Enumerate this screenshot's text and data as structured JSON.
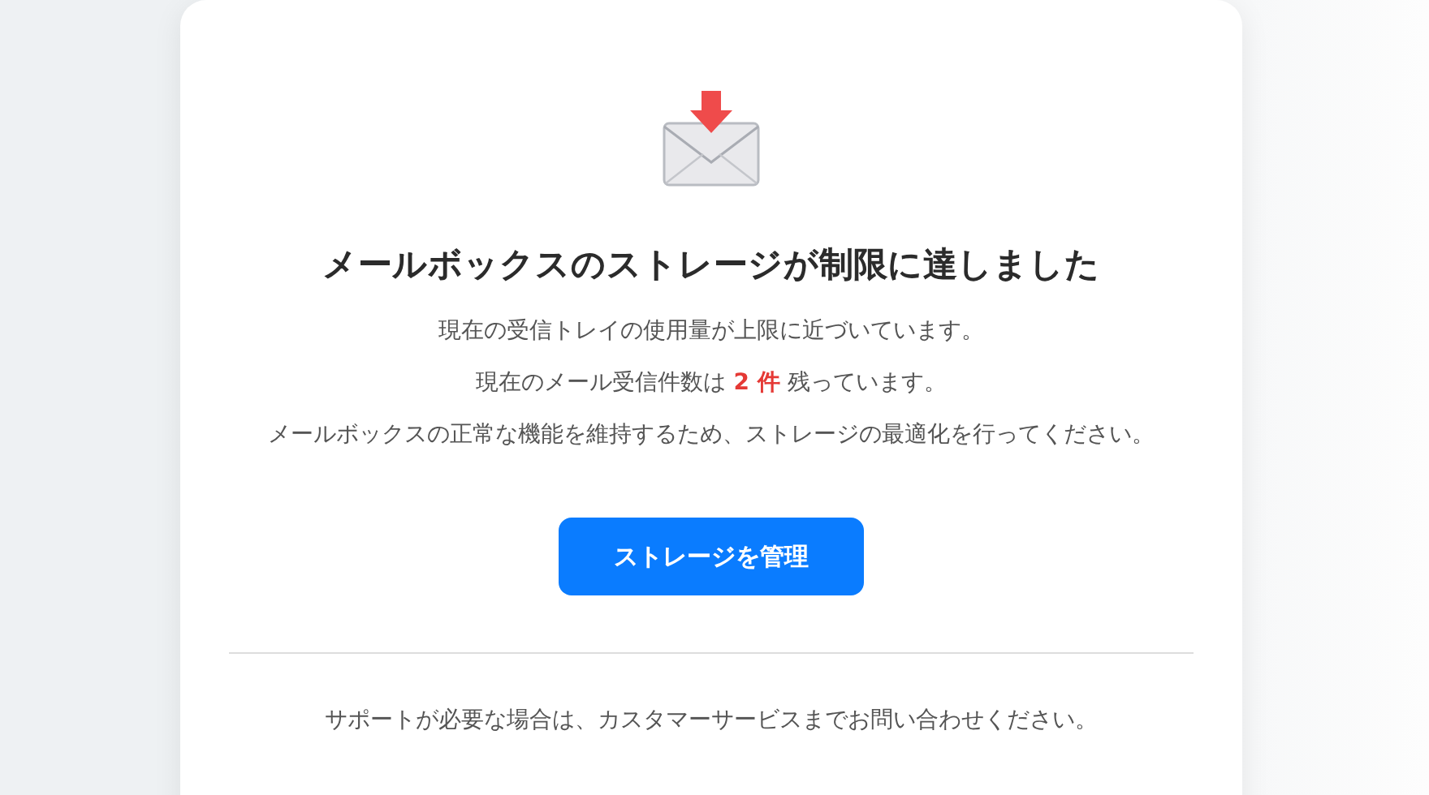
{
  "title": "メールボックスのストレージが制限に達しました",
  "paragraphs": [
    "現在の受信トレイの使用量が上限に近づいています。",
    "現在のメール受信件数は **2 件** 残っています。",
    "メールボックスの正常な機能を維持するため、ストレージの最適化を行ってください。"
  ],
  "button": "ストレージを管理",
  "footer": "サポートが必要な場合は、カスタマーサービスまでお問い合わせください。"
}
